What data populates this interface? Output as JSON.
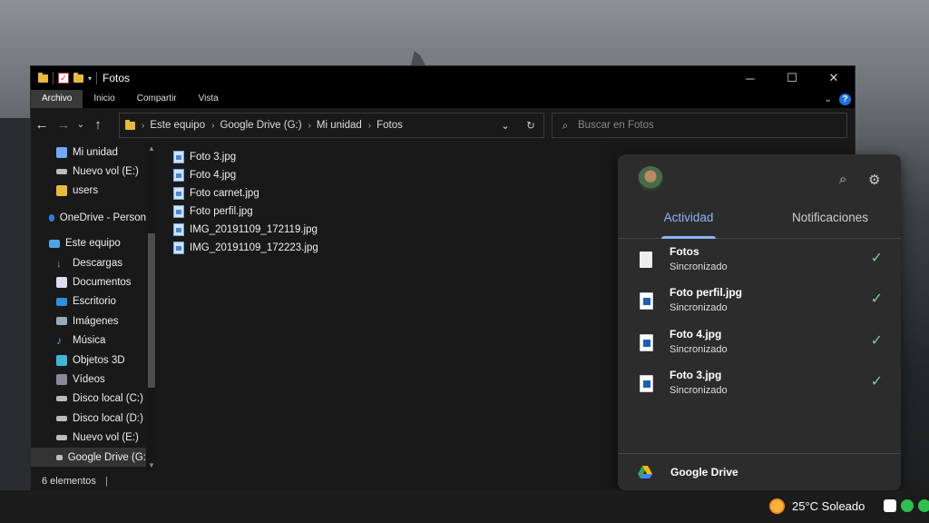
{
  "explorer": {
    "title": "Fotos",
    "ribbon_tabs": [
      "Archivo",
      "Inicio",
      "Compartir",
      "Vista"
    ],
    "help_label": "?",
    "breadcrumb": [
      "Este equipo",
      "Google Drive (G:)",
      "Mi unidad",
      "Fotos"
    ],
    "search_placeholder": "Buscar en Fotos",
    "sidebar": [
      {
        "label": "Mi unidad",
        "icon": "drive-folder-icon",
        "indent": true
      },
      {
        "label": "Nuevo vol (E:)",
        "icon": "drive-icon",
        "indent": true
      },
      {
        "label": "users",
        "icon": "folder-icon",
        "indent": true
      },
      {
        "label": "OneDrive - Person",
        "icon": "cloud-icon",
        "indent": false
      },
      {
        "label": "Este equipo",
        "icon": "computer-icon",
        "indent": false
      },
      {
        "label": "Descargas",
        "icon": "download-icon",
        "indent": true
      },
      {
        "label": "Documentos",
        "icon": "document-icon",
        "indent": true
      },
      {
        "label": "Escritorio",
        "icon": "desktop-icon",
        "indent": true
      },
      {
        "label": "Imágenes",
        "icon": "pictures-icon",
        "indent": true
      },
      {
        "label": "Música",
        "icon": "music-icon",
        "indent": true
      },
      {
        "label": "Objetos 3D",
        "icon": "cube-icon",
        "indent": true
      },
      {
        "label": "Vídeos",
        "icon": "video-icon",
        "indent": true
      },
      {
        "label": "Disco local (C:)",
        "icon": "drive-icon",
        "indent": true
      },
      {
        "label": "Disco local (D:)",
        "icon": "drive-icon",
        "indent": true
      },
      {
        "label": "Nuevo vol (E:)",
        "icon": "drive-icon",
        "indent": true
      },
      {
        "label": "Google Drive (G:",
        "icon": "drive-icon",
        "indent": true,
        "selected": true
      }
    ],
    "files": [
      "Foto 3.jpg",
      "Foto 4.jpg",
      "Foto carnet.jpg",
      "Foto perfil.jpg",
      "IMG_20191109_172119.jpg",
      "IMG_20191109_172223.jpg"
    ],
    "status": "6 elementos"
  },
  "drive_panel": {
    "tabs": [
      "Actividad",
      "Notificaciones"
    ],
    "items": [
      {
        "name": "Fotos",
        "status": "Sincronizado",
        "type": "folder"
      },
      {
        "name": "Foto perfil.jpg",
        "status": "Sincronizado",
        "type": "image"
      },
      {
        "name": "Foto 4.jpg",
        "status": "Sincronizado",
        "type": "image"
      },
      {
        "name": "Foto 3.jpg",
        "status": "Sincronizado",
        "type": "image"
      }
    ],
    "footer": "Google Drive"
  },
  "taskbar": {
    "weather": "25°C  Soleado"
  },
  "colors": {
    "accent": "#8ab4f8",
    "check": "#81c995",
    "folder": "#e8b93a"
  }
}
